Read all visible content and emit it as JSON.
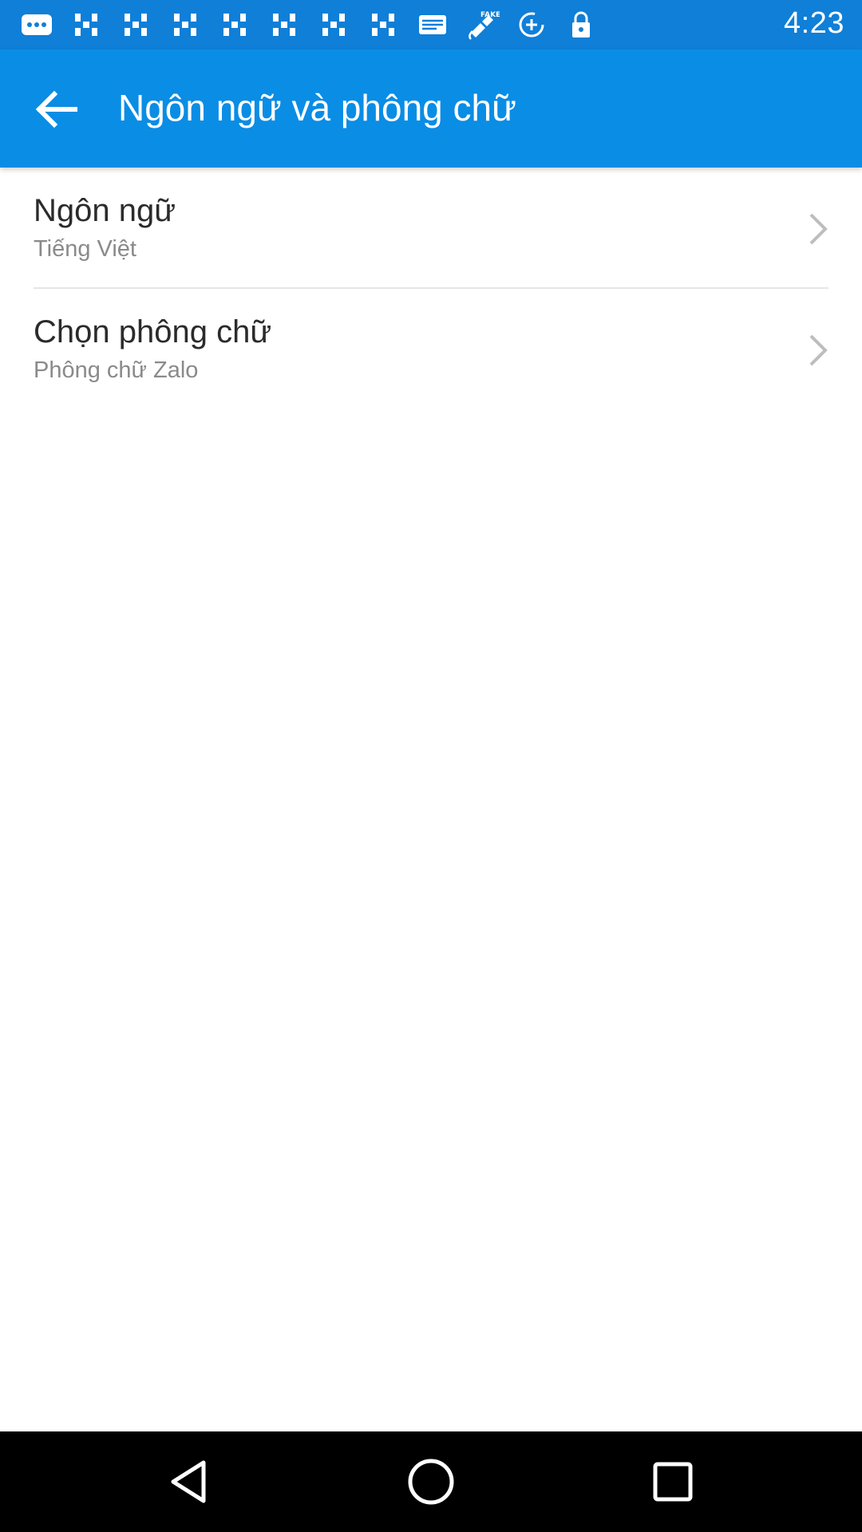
{
  "status_bar": {
    "time": "4:23",
    "icons": [
      "messenger-icon",
      "news-icon",
      "news-icon",
      "news-icon",
      "news-icon",
      "news-icon",
      "news-icon",
      "news-icon",
      "mail-icon",
      "fake-gps-icon",
      "data-saver-icon",
      "lock-icon"
    ],
    "fake_gps_label": "FAKE"
  },
  "app_bar": {
    "title": "Ngôn ngữ và phông chữ",
    "back_icon": "arrow-back-icon",
    "background": "#0a8de5"
  },
  "settings": {
    "items": [
      {
        "title": "Ngôn ngữ",
        "subtitle": "Tiếng Việt"
      },
      {
        "title": "Chọn phông chữ",
        "subtitle": "Phông chữ Zalo"
      }
    ]
  },
  "nav_bar": {
    "buttons": [
      "back-triangle-icon",
      "home-circle-icon",
      "recents-square-icon"
    ]
  }
}
